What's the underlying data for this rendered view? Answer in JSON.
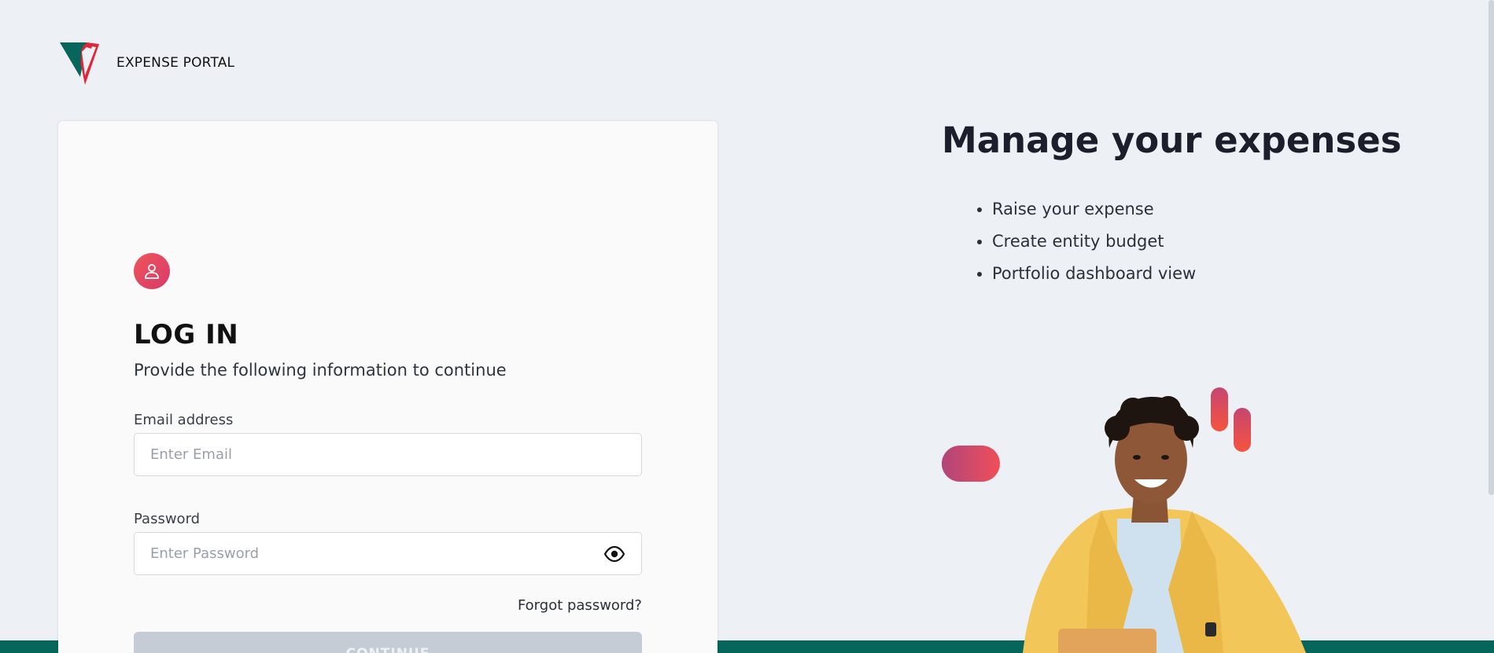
{
  "brand": {
    "name": "EXPENSE PORTAL",
    "colors": {
      "teal": "#06665c",
      "red": "#e0263a"
    }
  },
  "login": {
    "title": "LOG IN",
    "subtitle": "Provide the following information to continue",
    "email": {
      "label": "Email address",
      "placeholder": "Enter Email",
      "value": ""
    },
    "password": {
      "label": "Password",
      "placeholder": "Enter Password",
      "value": ""
    },
    "forgot_label": "Forgot password?",
    "continue_label": "CONTINUE"
  },
  "hero": {
    "title": "Manage your expenses",
    "features": [
      "Raise your expense",
      "Create entity budget",
      "Portfolio dashboard view"
    ]
  },
  "icons": {
    "user": "user-icon",
    "eye": "eye-icon",
    "logo": "logo-icon"
  },
  "colors": {
    "background": "#edf1f5",
    "card": "#fafafa",
    "accent_gradient_start": "#f0555a",
    "accent_gradient_end": "#d63a6a",
    "button_disabled": "#c6ccd5",
    "footer": "#06665c"
  }
}
